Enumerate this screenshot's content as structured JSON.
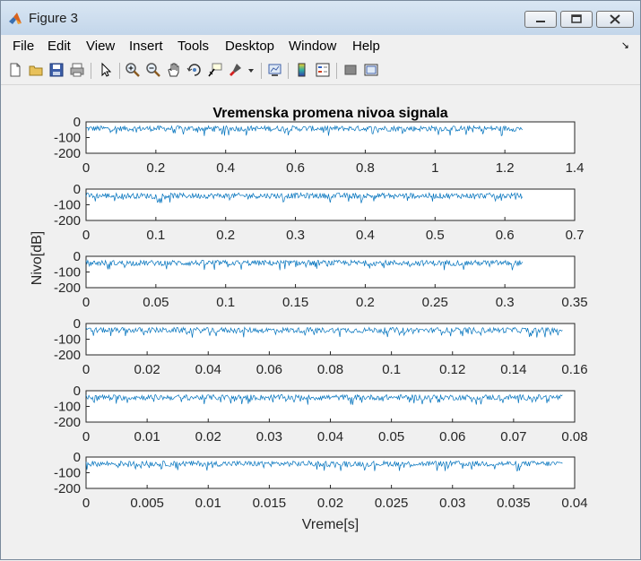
{
  "window": {
    "title": "Figure 3",
    "icon": "matlab-logo-icon"
  },
  "menu": [
    "File",
    "Edit",
    "View",
    "Insert",
    "Tools",
    "Desktop",
    "Window",
    "Help"
  ],
  "toolbar": {
    "icons": [
      "new-figure-icon",
      "open-file-icon",
      "save-icon",
      "print-icon",
      "edit-plot-arrow-icon",
      "zoom-in-icon",
      "zoom-out-icon",
      "pan-hand-icon",
      "rotate-3d-icon",
      "data-cursor-icon",
      "brush-icon",
      "brush-dropdown-icon",
      "link-plot-icon",
      "insert-colorbar-icon",
      "insert-legend-icon",
      "hide-plot-tools-icon",
      "show-plot-tools-icon"
    ]
  },
  "chart_data": [
    {
      "type": "line",
      "title": "Vremenska promena nivoa signala",
      "xlim": [
        0,
        1.4
      ],
      "ylim": [
        -200,
        0
      ],
      "xticks": [
        "0",
        "0.2",
        "0.4",
        "0.6",
        "0.8",
        "1",
        "1.2",
        "1.4"
      ],
      "yticks": [
        "0",
        "-100",
        "-200"
      ],
      "series": [
        {
          "x_range": [
            0,
            1.25
          ],
          "level_range": [
            -60,
            -25
          ],
          "color": "#0072bd"
        }
      ]
    },
    {
      "type": "line",
      "xlim": [
        0,
        0.7
      ],
      "ylim": [
        -200,
        0
      ],
      "xticks": [
        "0",
        "0.1",
        "0.2",
        "0.3",
        "0.4",
        "0.5",
        "0.6",
        "0.7"
      ],
      "yticks": [
        "0",
        "-100",
        "-200"
      ],
      "series": [
        {
          "x_range": [
            0,
            0.625
          ],
          "level_range": [
            -60,
            -25
          ],
          "color": "#0072bd"
        }
      ]
    },
    {
      "type": "line",
      "xlim": [
        0,
        0.35
      ],
      "ylim": [
        -200,
        0
      ],
      "xticks": [
        "0",
        "0.05",
        "0.1",
        "0.15",
        "0.2",
        "0.25",
        "0.3",
        "0.35"
      ],
      "yticks": [
        "0",
        "-100",
        "-200"
      ],
      "ylabel": "Nivo[dB]",
      "series": [
        {
          "x_range": [
            0,
            0.3125
          ],
          "level_range": [
            -60,
            -25
          ],
          "color": "#0072bd"
        }
      ]
    },
    {
      "type": "line",
      "xlim": [
        0,
        0.16
      ],
      "ylim": [
        -200,
        0
      ],
      "xticks": [
        "0",
        "0.02",
        "0.04",
        "0.06",
        "0.08",
        "0.1",
        "0.12",
        "0.14",
        "0.16"
      ],
      "yticks": [
        "0",
        "-100",
        "-200"
      ],
      "series": [
        {
          "x_range": [
            0,
            0.156
          ],
          "level_range": [
            -60,
            -25
          ],
          "color": "#0072bd"
        }
      ]
    },
    {
      "type": "line",
      "xlim": [
        0,
        0.08
      ],
      "ylim": [
        -200,
        0
      ],
      "xticks": [
        "0",
        "0.01",
        "0.02",
        "0.03",
        "0.04",
        "0.05",
        "0.06",
        "0.07",
        "0.08"
      ],
      "yticks": [
        "0",
        "-100",
        "-200"
      ],
      "series": [
        {
          "x_range": [
            0,
            0.078
          ],
          "level_range": [
            -60,
            -25
          ],
          "color": "#0072bd"
        }
      ]
    },
    {
      "type": "line",
      "xlim": [
        0,
        0.04
      ],
      "ylim": [
        -200,
        0
      ],
      "xticks": [
        "0",
        "0.005",
        "0.01",
        "0.015",
        "0.02",
        "0.025",
        "0.03",
        "0.035",
        "0.04"
      ],
      "yticks": [
        "0",
        "-100",
        "-200"
      ],
      "xlabel": "Vreme[s]",
      "series": [
        {
          "x_range": [
            0,
            0.039
          ],
          "level_range": [
            -60,
            -25
          ],
          "color": "#0072bd"
        }
      ]
    }
  ]
}
